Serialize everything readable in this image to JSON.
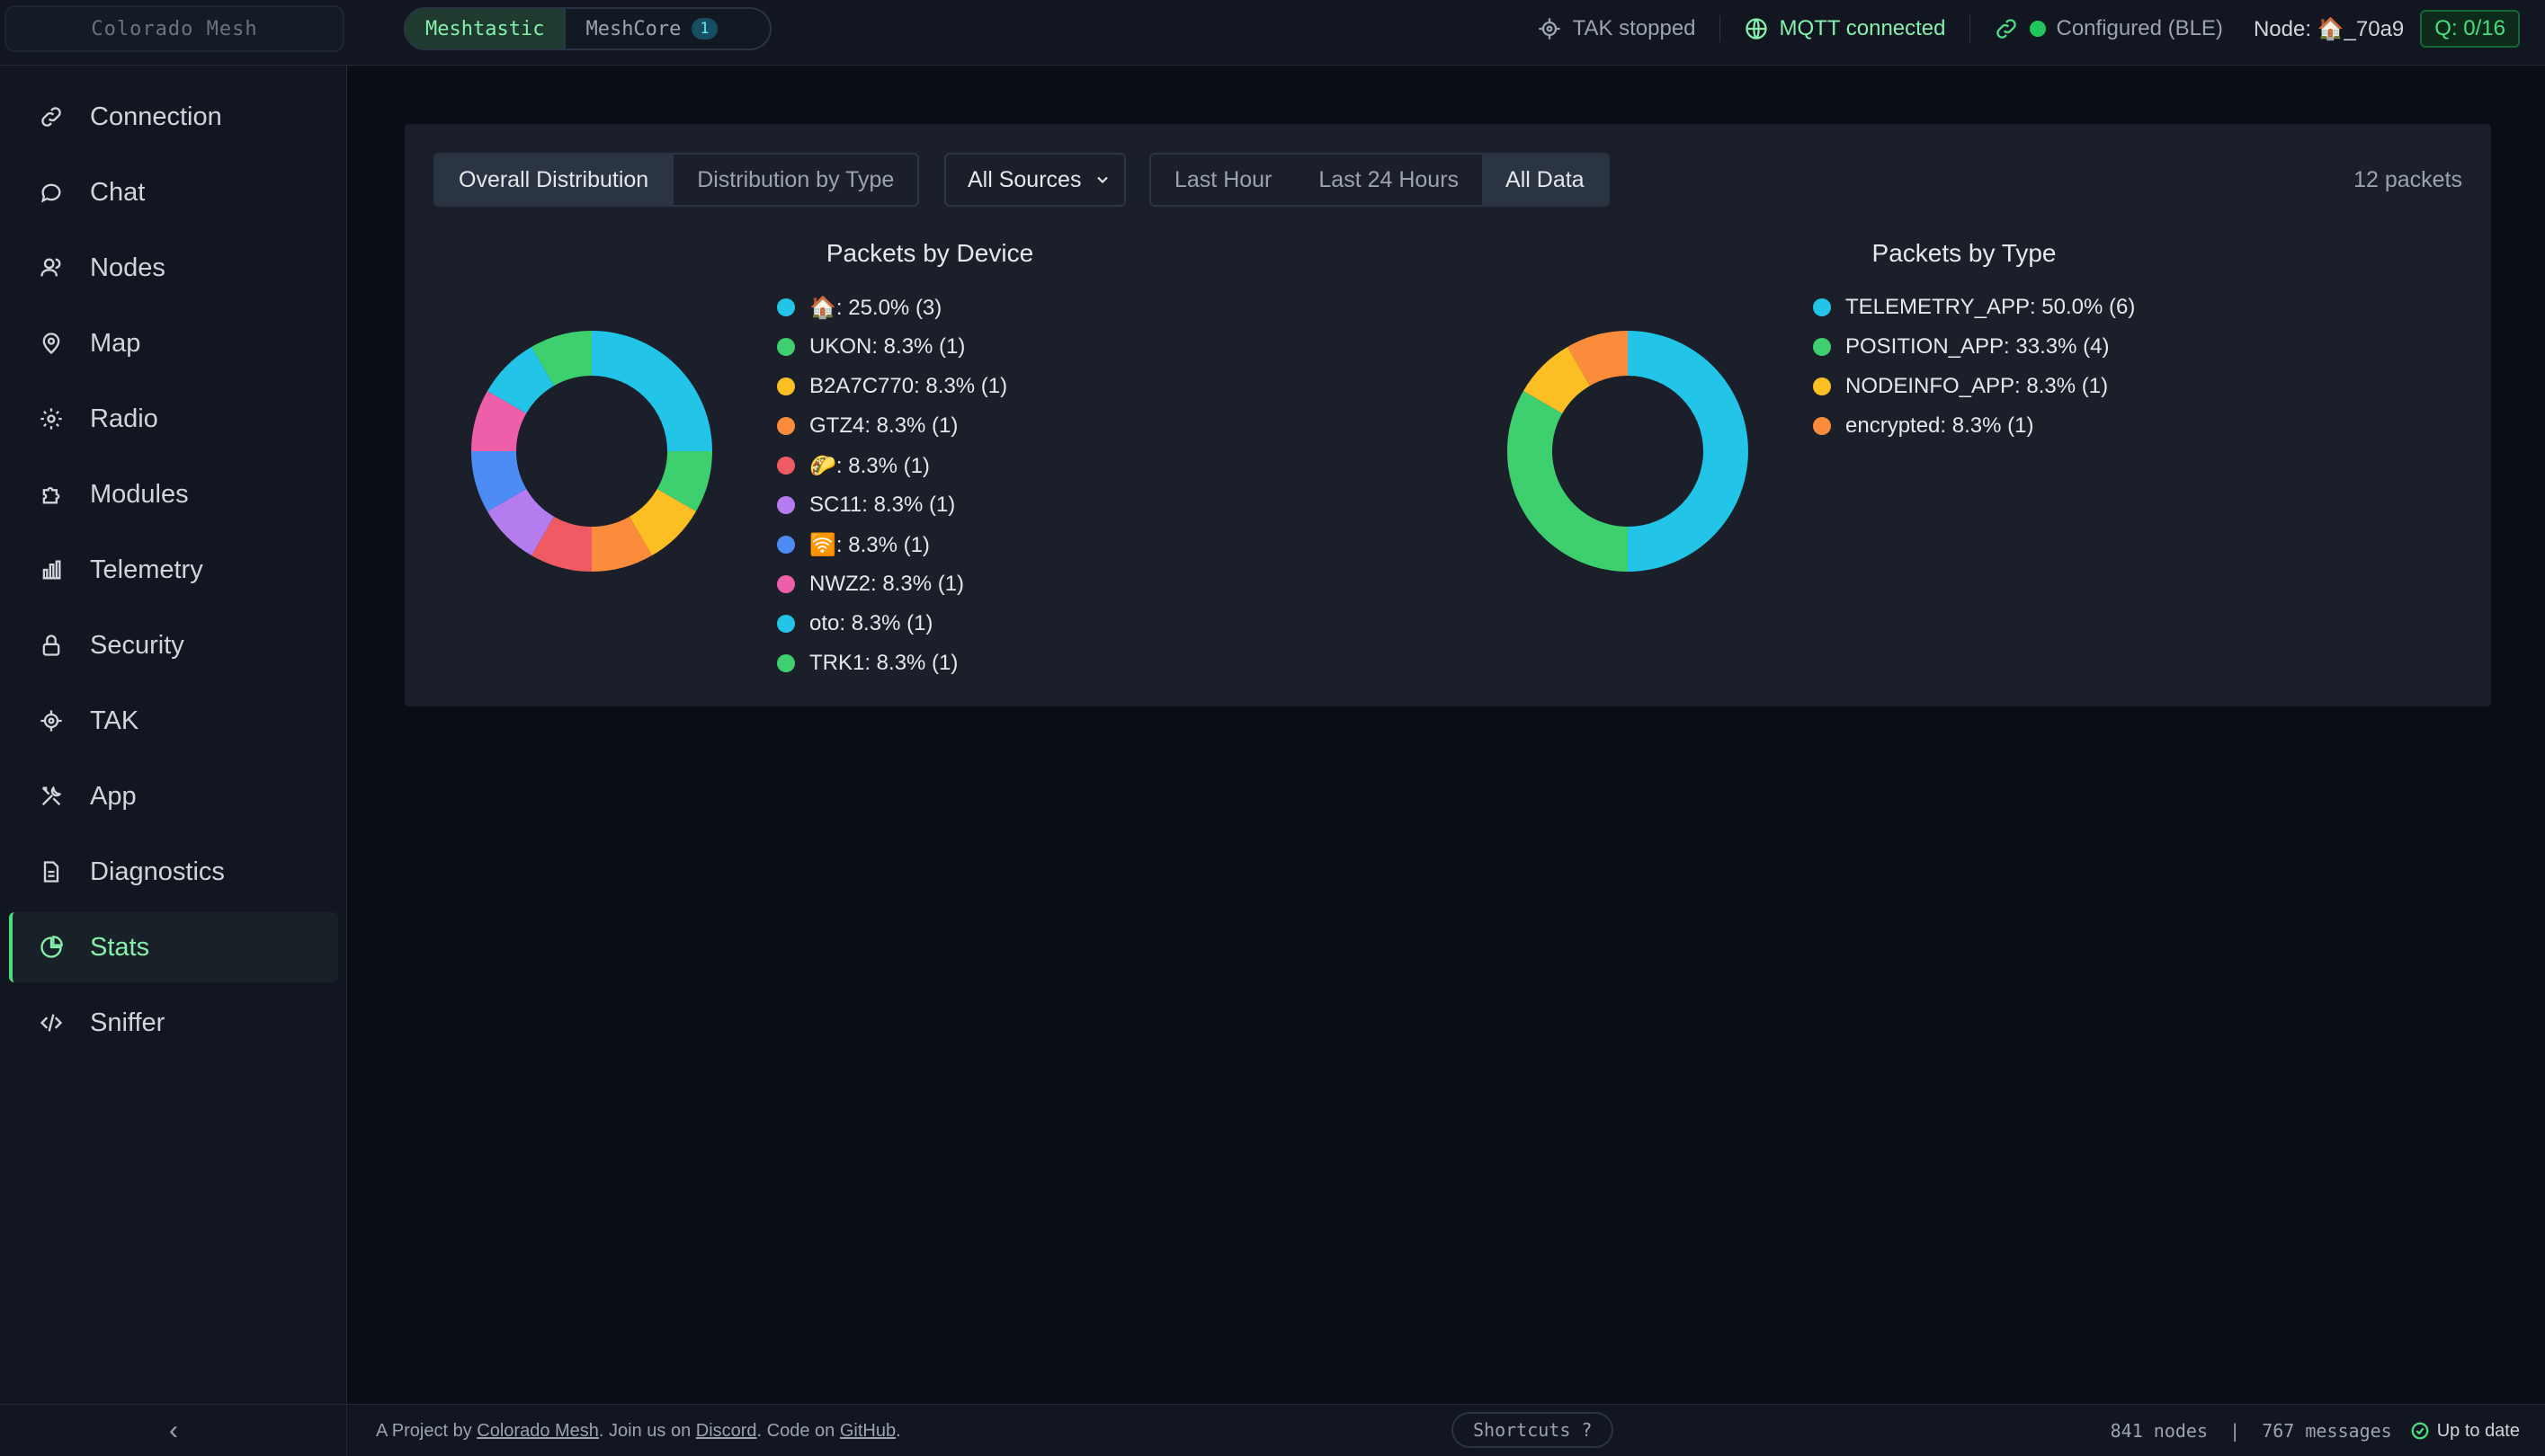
{
  "header": {
    "logo_text": "Colorado Mesh",
    "protocol_tabs": [
      {
        "label": "Meshtastic",
        "active": true
      },
      {
        "label": "MeshCore",
        "badge": "1"
      }
    ],
    "tak_status": "TAK stopped",
    "mqtt_status": "MQTT connected",
    "connection_status": "Configured (BLE)",
    "node_label": "Node: 🏠_70a9",
    "queue": "Q: 0/16"
  },
  "sidebar": {
    "items": [
      {
        "label": "Connection",
        "icon": "link-icon"
      },
      {
        "label": "Chat",
        "icon": "chat-bubble-icon"
      },
      {
        "label": "Nodes",
        "icon": "nodes-icon"
      },
      {
        "label": "Map",
        "icon": "map-pin-icon"
      },
      {
        "label": "Radio",
        "icon": "gear-icon"
      },
      {
        "label": "Modules",
        "icon": "puzzle-icon"
      },
      {
        "label": "Telemetry",
        "icon": "bar-chart-icon"
      },
      {
        "label": "Security",
        "icon": "lock-icon"
      },
      {
        "label": "TAK",
        "icon": "crosshair-icon"
      },
      {
        "label": "App",
        "icon": "tools-icon"
      },
      {
        "label": "Diagnostics",
        "icon": "document-icon"
      },
      {
        "label": "Stats",
        "icon": "pie-chart-icon",
        "active": true
      },
      {
        "label": "Sniffer",
        "icon": "code-icon"
      }
    ],
    "collapse_label": "‹"
  },
  "stats": {
    "view_tabs": [
      {
        "label": "Overall Distribution",
        "active": true
      },
      {
        "label": "Distribution by Type"
      }
    ],
    "source_select": "All Sources",
    "time_tabs": [
      {
        "label": "Last Hour"
      },
      {
        "label": "Last 24 Hours"
      },
      {
        "label": "All Data",
        "active": true
      }
    ],
    "packet_count": "12 packets"
  },
  "chart_data": [
    {
      "type": "pie",
      "title": "Packets by Device",
      "categories": [
        "🏠",
        "UKON",
        "B2A7C770",
        "GTZ4",
        "🌮",
        "SC11",
        "🛜",
        "NWZ2",
        "oto",
        "TRK1"
      ],
      "values": [
        3,
        1,
        1,
        1,
        1,
        1,
        1,
        1,
        1,
        1
      ],
      "legend_labels": [
        "🏠: 25.0% (3)",
        "UKON: 8.3% (1)",
        "B2A7C770: 8.3% (1)",
        "GTZ4: 8.3% (1)",
        "🌮: 8.3% (1)",
        "SC11: 8.3% (1)",
        "🛜: 8.3% (1)",
        "NWZ2: 8.3% (1)",
        "oto: 8.3% (1)",
        "TRK1: 8.3% (1)"
      ],
      "colors": [
        "#22c4e8",
        "#3ecf6e",
        "#fbbf24",
        "#fb8c3c",
        "#f05a63",
        "#b57cf0",
        "#4d8cf5",
        "#ef5ea8",
        "#22c4e8",
        "#3ecf6e"
      ],
      "legend_placement": "right"
    },
    {
      "type": "pie",
      "title": "Packets by Type",
      "categories": [
        "TELEMETRY_APP",
        "POSITION_APP",
        "NODEINFO_APP",
        "encrypted"
      ],
      "values": [
        6,
        4,
        1,
        1
      ],
      "legend_labels": [
        "TELEMETRY_APP: 50.0% (6)",
        "POSITION_APP: 33.3% (4)",
        "NODEINFO_APP: 8.3% (1)",
        "encrypted: 8.3% (1)"
      ],
      "colors": [
        "#22c4e8",
        "#3ecf6e",
        "#fbbf24",
        "#fb8c3c"
      ],
      "legend_placement": "right"
    }
  ],
  "footer": {
    "prefix": "A Project by ",
    "link1": "Colorado Mesh",
    "mid1": ". Join us on ",
    "link2": "Discord",
    "mid2": ". Code on ",
    "link3": "GitHub",
    "suffix": ".",
    "shortcuts": "Shortcuts ?",
    "stats": "841 nodes  |  767 messages",
    "update_status": "Up to date"
  }
}
